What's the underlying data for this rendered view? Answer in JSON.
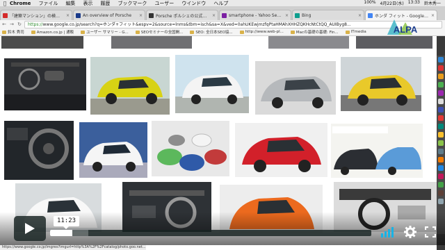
{
  "menubar": {
    "app": "Chrome",
    "items": [
      "ファイル",
      "編集",
      "表示",
      "履歴",
      "ブックマーク",
      "ユーザー",
      "ウインドウ",
      "ヘルプ"
    ],
    "battery": "100%",
    "date": "4月22日(水)",
    "time": "13:33",
    "user": "鈴木秀一"
  },
  "tabs": [
    {
      "title": "「建築マンション」の検索結果",
      "color": "#d42a2a"
    },
    {
      "title": "An overview of Porsche",
      "color": "#1a3a8a"
    },
    {
      "title": "Porsche ポルシェの公式サイト",
      "color": "#333333"
    },
    {
      "title": "smartphone - Yahoo Search",
      "color": "#7b1fa2"
    },
    {
      "title": "Bing",
      "color": "#0e9e8e"
    },
    {
      "title": "ホンダ フィット - Google 検索",
      "color": "#4285f4"
    }
  ],
  "address": {
    "scheme": "https://",
    "url": "www.google.co.jp/search?q=ホンダ+フィット&espv=2&source=lnms&tbm=isch&sa=X&ved=0ahUKEwjmzfqPtaHMAhXHHZQKHcNtCtQQ_AUIByg8..."
  },
  "bookmarks": [
    "鈴木 秀司",
    "Amazon.co.jp | 通販",
    "ユーザー サマリー - G...",
    "SEOセミナーの全国開...",
    "SEO: 全日本SEO協...",
    "http://www.web-pl...",
    "Macの基礎の基礎: Fin...",
    "ITmedia"
  ],
  "logo_text": "ALPA",
  "video": {
    "timecode": "11:23",
    "played_fraction": 0.07,
    "loaded_fraction": 0.12
  },
  "status_url": "https://www.google.co.jp/imgres?imgurl=http%3A%2F%2Fcatalog/photo.goo.net...",
  "icons": [
    "apple-icon",
    "play-icon",
    "volume-icon",
    "settings-icon",
    "fullscreen-icon"
  ]
}
